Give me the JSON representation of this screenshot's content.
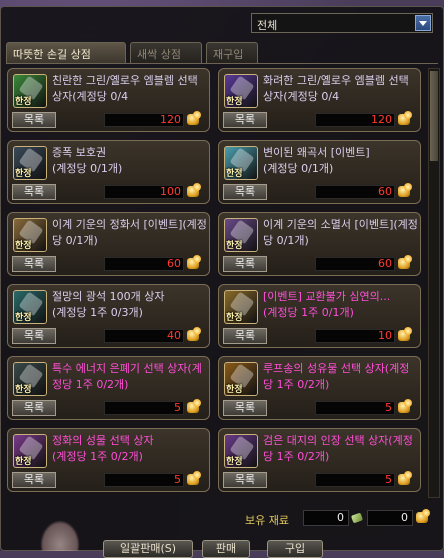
{
  "filter": {
    "selected": "전체"
  },
  "tabs": [
    {
      "label": "따뜻한 손길 상점",
      "active": true
    },
    {
      "label": "새싹 상점",
      "active": false
    },
    {
      "label": "재구입",
      "active": false
    }
  ],
  "item_tag": "한정",
  "list_button_label": "목록",
  "items": [
    {
      "name": "친란한 그린/옐로우 엠블렘 선택 상자(계정당 0/4",
      "price": "120",
      "icon": "emblem-box-icon",
      "color": "#3a8a3a"
    },
    {
      "name": "화려한 그린/옐로우 엠블렘 선택 상자(계정당 0/4",
      "price": "120",
      "icon": "emblem-box-icon",
      "color": "#5a3a9a"
    },
    {
      "name": "증폭 보호권\n(계정당 0/1개)",
      "price": "100",
      "icon": "hammer-icon",
      "color": "#3a4a5a"
    },
    {
      "name": "변이된 왜곡서 [이벤트]\n(계정당 0/1개)",
      "price": "60",
      "icon": "scroll-icon",
      "color": "#4aa0b0"
    },
    {
      "name": "이계 기운의 정화서 [이벤트](계정당 0/1개)",
      "price": "60",
      "icon": "scroll-icon",
      "color": "#8a6a3a"
    },
    {
      "name": "이계 기운의 소멸서 [이벤트](계정당 0/1개)",
      "price": "60",
      "icon": "scroll-icon",
      "color": "#6a4a8a"
    },
    {
      "name": "절망의 광석 100개 상자\n(계정당 1주 0/3개)",
      "price": "40",
      "icon": "ore-box-icon",
      "color": "#2a6a6a"
    },
    {
      "name": "[이벤트] 교환불가 심연의...\n(계정당 1주 0/1개)",
      "price": "10",
      "icon": "chest-icon",
      "color": "#8a6a2a",
      "special": true
    },
    {
      "name": "특수 에너지 은폐기 선택 상자(계정당 1주 0/2개)",
      "price": "5",
      "icon": "device-box-icon",
      "color": "#3a4a4a",
      "special": true
    },
    {
      "name": "루프송의 성유물 선택 상자(계정당 1주 0/2개)",
      "price": "5",
      "icon": "relic-box-icon",
      "color": "#8a5a1a",
      "special": true
    },
    {
      "name": "정화의 성물 선택 상자\n(계정당 1주 0/2개)",
      "price": "5",
      "icon": "relic-box-icon",
      "color": "#7a3a8a",
      "special": true
    },
    {
      "name": "검은 대지의 인장 선택 상자(계정당 1주 0/2개)",
      "price": "5",
      "icon": "seal-box-icon",
      "color": "#6a3a8a",
      "special": true
    }
  ],
  "stock": {
    "label": "보유 재료",
    "material_1": "0",
    "material_2": "0"
  },
  "bottom_buttons": [
    "일괄판매(S)",
    "판매",
    "구입"
  ]
}
